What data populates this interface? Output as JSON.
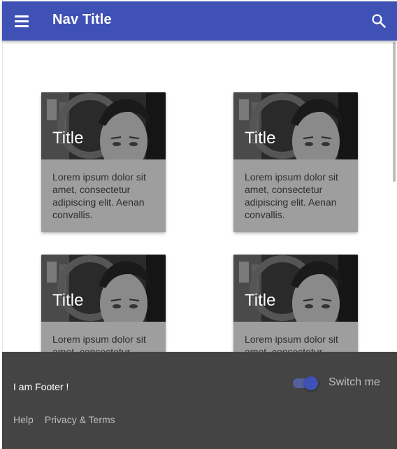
{
  "app_bar": {
    "title": "Nav Title",
    "menu_icon": "menu-icon",
    "search_icon": "search-icon",
    "color": "#3f51b5"
  },
  "cards": [
    {
      "title": "Title",
      "text": "Lorem ipsum dolor sit amet, consectetur adipiscing elit. Aenan convallis."
    },
    {
      "title": "Title",
      "text": "Lorem ipsum dolor sit amet, consectetur adipiscing elit. Aenan convallis."
    },
    {
      "title": "Title",
      "text": "Lorem ipsum dolor sit amet, consectetur adipiscing elit. Aenan convallis."
    },
    {
      "title": "Title",
      "text": "Lorem ipsum dolor sit amet, consectetur adipiscing elit. Aenan convallis."
    }
  ],
  "footer": {
    "text": "I am Footer !",
    "switch_label": "Switch me",
    "switch_on": true,
    "links": [
      "Help",
      "Privacy & Terms"
    ],
    "background": "#444444"
  }
}
